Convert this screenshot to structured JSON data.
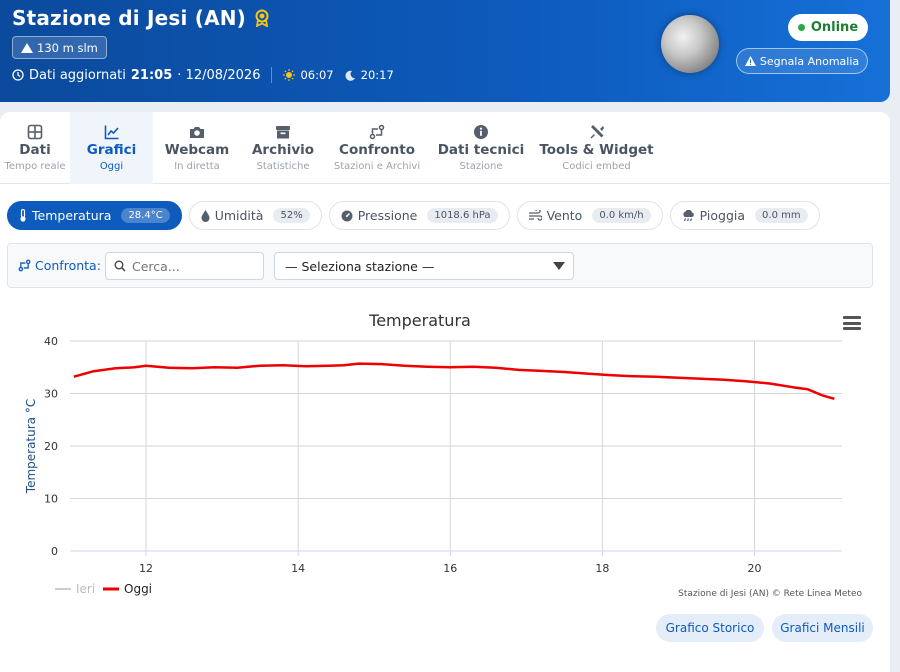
{
  "header": {
    "title": "Stazione di Jesi (AN)",
    "altitude": "130 m slm",
    "updated_label": "Dati aggiornati",
    "updated_time": "21:05",
    "updated_date": "· 12/08/2026",
    "sunrise": "06:07",
    "sunset": "20:17",
    "status": "Online",
    "report_button": "Segnala Anomalia"
  },
  "tabs": [
    {
      "label": "Dati",
      "sub": "Tempo reale",
      "icon": "grid-icon"
    },
    {
      "label": "Grafici",
      "sub": "Oggi",
      "icon": "chart-icon",
      "active": true
    },
    {
      "label": "Webcam",
      "sub": "In diretta",
      "icon": "camera-icon"
    },
    {
      "label": "Archivio",
      "sub": "Statistiche",
      "icon": "archive-icon"
    },
    {
      "label": "Confronto",
      "sub": "Stazioni e Archivi",
      "icon": "compare-icon"
    },
    {
      "label": "Dati tecnici",
      "sub": "Stazione",
      "icon": "info-icon"
    },
    {
      "label": "Tools & Widget",
      "sub": "Codici embed",
      "icon": "tools-icon"
    }
  ],
  "pills": [
    {
      "label": "Temperatura",
      "value": "28.4°C",
      "icon": "thermometer-icon",
      "active": true
    },
    {
      "label": "Umidità",
      "value": "52%",
      "icon": "droplet-icon"
    },
    {
      "label": "Pressione",
      "value": "1018.6 hPa",
      "icon": "gauge-icon"
    },
    {
      "label": "Vento",
      "value": "0.0 km/h",
      "icon": "wind-icon"
    },
    {
      "label": "Pioggia",
      "value": "0.0 mm",
      "icon": "rain-icon"
    }
  ],
  "compare": {
    "label": "Confronta:",
    "search_placeholder": "Cerca...",
    "select_value": "— Seleziona stazione —"
  },
  "chart_data": {
    "type": "line",
    "title": "Temperatura",
    "xlabel": "",
    "ylabel": "Temperatura °C",
    "xlim": [
      11.0,
      21.15
    ],
    "ylim": [
      0,
      40
    ],
    "x_ticks": [
      12,
      14,
      16,
      18,
      20
    ],
    "y_ticks": [
      0,
      10,
      20,
      30,
      40
    ],
    "grid": true,
    "legend_position": "bottom-left",
    "credit": "Stazione di Jesi (AN) © Rete Linea Meteo",
    "series": [
      {
        "name": "Ieri",
        "color": "#cccccc",
        "x": [],
        "y": []
      },
      {
        "name": "Oggi",
        "color": "#ee0000",
        "x": [
          11.05,
          11.3,
          11.6,
          11.85,
          12.0,
          12.3,
          12.6,
          12.9,
          13.2,
          13.5,
          13.8,
          14.1,
          14.4,
          14.6,
          14.8,
          15.1,
          15.4,
          15.7,
          16.0,
          16.3,
          16.6,
          16.9,
          17.2,
          17.5,
          17.8,
          18.1,
          18.4,
          18.7,
          19.0,
          19.3,
          19.6,
          19.9,
          20.2,
          20.5,
          20.7,
          20.9,
          21.05
        ],
        "y": [
          33.2,
          34.2,
          34.8,
          35.0,
          35.3,
          34.9,
          34.8,
          35.0,
          34.9,
          35.3,
          35.4,
          35.2,
          35.3,
          35.4,
          35.7,
          35.6,
          35.3,
          35.1,
          35.0,
          35.1,
          34.9,
          34.5,
          34.3,
          34.1,
          33.8,
          33.5,
          33.3,
          33.2,
          33.0,
          32.8,
          32.6,
          32.3,
          31.9,
          31.2,
          30.8,
          29.6,
          29.0
        ]
      }
    ]
  },
  "buttons": {
    "historic": "Grafico Storico",
    "monthly": "Grafici Mensili"
  }
}
